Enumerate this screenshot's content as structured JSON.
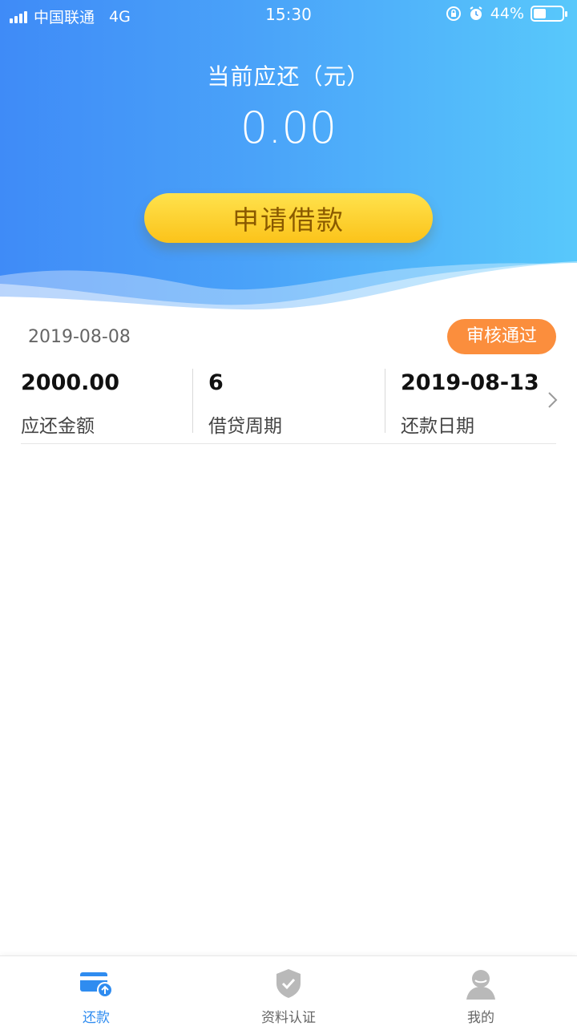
{
  "status_bar": {
    "carrier": "中国联通",
    "network": "4G",
    "time": "15:30",
    "battery_text": "44%",
    "battery_level": 0.44
  },
  "header": {
    "due_label": "当前应还（元）",
    "due_amount": "0.00",
    "apply_button_label": "申请借款"
  },
  "record": {
    "date": "2019-08-08",
    "status": "审核通过",
    "stats": [
      {
        "value": "2000.00",
        "label": "应还金额"
      },
      {
        "value": "6",
        "label": "借贷周期"
      },
      {
        "value": "2019-08-13",
        "label": "还款日期"
      }
    ]
  },
  "tab_bar": {
    "tabs": [
      {
        "label": "还款",
        "icon": "card-repay-icon",
        "active": true
      },
      {
        "label": "资料认证",
        "icon": "shield-check-icon",
        "active": false
      },
      {
        "label": "我的",
        "icon": "user-avatar-icon",
        "active": false
      }
    ]
  },
  "colors": {
    "primary_blue": "#2f8cf0",
    "button_yellow": "#fbc31a",
    "badge_orange": "#fb8e3d"
  }
}
